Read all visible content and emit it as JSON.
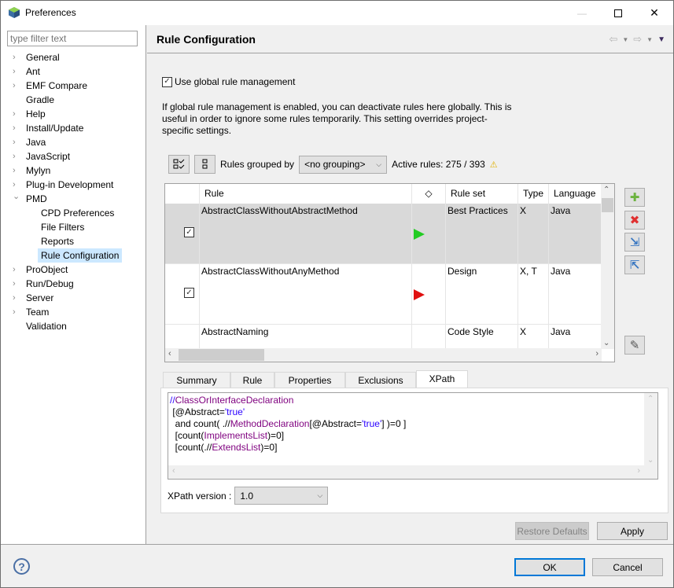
{
  "window": {
    "title": "Preferences",
    "controls": {
      "minimize": "—",
      "maximize": "☐",
      "close": "✕"
    }
  },
  "sidebar": {
    "filter_placeholder": "type filter text",
    "items": [
      {
        "label": "General",
        "expandable": true,
        "expanded": false
      },
      {
        "label": "Ant",
        "expandable": true,
        "expanded": false
      },
      {
        "label": "EMF Compare",
        "expandable": true,
        "expanded": false
      },
      {
        "label": "Gradle",
        "expandable": false
      },
      {
        "label": "Help",
        "expandable": true,
        "expanded": false
      },
      {
        "label": "Install/Update",
        "expandable": true,
        "expanded": false
      },
      {
        "label": "Java",
        "expandable": true,
        "expanded": false
      },
      {
        "label": "JavaScript",
        "expandable": true,
        "expanded": false
      },
      {
        "label": "Mylyn",
        "expandable": true,
        "expanded": false
      },
      {
        "label": "Plug-in Development",
        "expandable": true,
        "expanded": false
      },
      {
        "label": "PMD",
        "expandable": true,
        "expanded": true
      },
      {
        "label": "CPD Preferences",
        "child": true
      },
      {
        "label": "File Filters",
        "child": true
      },
      {
        "label": "Reports",
        "child": true
      },
      {
        "label": "Rule Configuration",
        "child": true,
        "selected": true
      },
      {
        "label": "ProObject",
        "expandable": true,
        "expanded": false
      },
      {
        "label": "Run/Debug",
        "expandable": true,
        "expanded": false
      },
      {
        "label": "Server",
        "expandable": true,
        "expanded": false
      },
      {
        "label": "Team",
        "expandable": true,
        "expanded": false
      },
      {
        "label": "Validation",
        "expandable": false
      }
    ]
  },
  "page": {
    "title": "Rule Configuration",
    "use_global_label": "Use global rule management",
    "use_global_checked": true,
    "description": "If global rule management is enabled, you can deactivate rules here globally. This is useful in order to ignore some rules temporarily. This setting overrides project-specific settings.",
    "grouped_by_label": "Rules grouped by",
    "grouping_value": "<no grouping>",
    "active_rules_label": "Active rules: 275 / 393"
  },
  "table": {
    "columns": [
      "",
      "Rule",
      "◇",
      "Rule set",
      "Type",
      "Language"
    ],
    "rows": [
      {
        "checked": true,
        "rule": "AbstractClassWithoutAbstractMethod",
        "priority_color": "#22cc22",
        "ruleset": "Best Practices",
        "type": "X",
        "language": "Java",
        "selected": true
      },
      {
        "checked": true,
        "rule": "AbstractClassWithoutAnyMethod",
        "priority_color": "#e01010",
        "ruleset": "Design",
        "type": "X, T",
        "language": "Java",
        "selected": false
      },
      {
        "checked": false,
        "rule": "AbstractNaming",
        "priority_color": null,
        "ruleset": "Code Style",
        "type": "X",
        "language": "Java",
        "selected": false
      }
    ]
  },
  "side_buttons": [
    {
      "name": "add-rule",
      "glyph": "✚",
      "color": "#6cb33f"
    },
    {
      "name": "remove-rule",
      "glyph": "✖",
      "color": "#e03030"
    },
    {
      "name": "import-rules",
      "glyph": "⇲",
      "color": "#3a78c2"
    },
    {
      "name": "export-rules",
      "glyph": "⇱",
      "color": "#3a78c2"
    },
    {
      "name": "edit-rule",
      "glyph": "✎",
      "color": "#555555"
    }
  ],
  "tabs": [
    "Summary",
    "Rule",
    "Properties",
    "Exclusions",
    "XPath"
  ],
  "active_tab": "XPath",
  "xpath": {
    "lines": [
      [
        {
          "t": "//",
          "c": "blue"
        },
        {
          "t": "ClassOrInterfaceDeclaration",
          "c": "purple"
        }
      ],
      [
        {
          "t": " [@Abstract=",
          "c": ""
        },
        {
          "t": "'true'",
          "c": "blue"
        }
      ],
      [
        {
          "t": "  and count( .//",
          "c": ""
        },
        {
          "t": "MethodDeclaration",
          "c": "purple"
        },
        {
          "t": "[@Abstract=",
          "c": ""
        },
        {
          "t": "'true'",
          "c": "blue"
        },
        {
          "t": "] )=0 ]",
          "c": ""
        }
      ],
      [
        {
          "t": "  [count(",
          "c": ""
        },
        {
          "t": "ImplementsList",
          "c": "purple"
        },
        {
          "t": ")=0]",
          "c": ""
        }
      ],
      [
        {
          "t": "  [count(.//",
          "c": ""
        },
        {
          "t": "ExtendsList",
          "c": "purple"
        },
        {
          "t": ")=0]",
          "c": ""
        }
      ]
    ],
    "version_label": "XPath version :",
    "version_value": "1.0"
  },
  "buttons": {
    "restore_defaults": "Restore Defaults",
    "apply": "Apply",
    "ok": "OK",
    "cancel": "Cancel",
    "help": "?"
  }
}
